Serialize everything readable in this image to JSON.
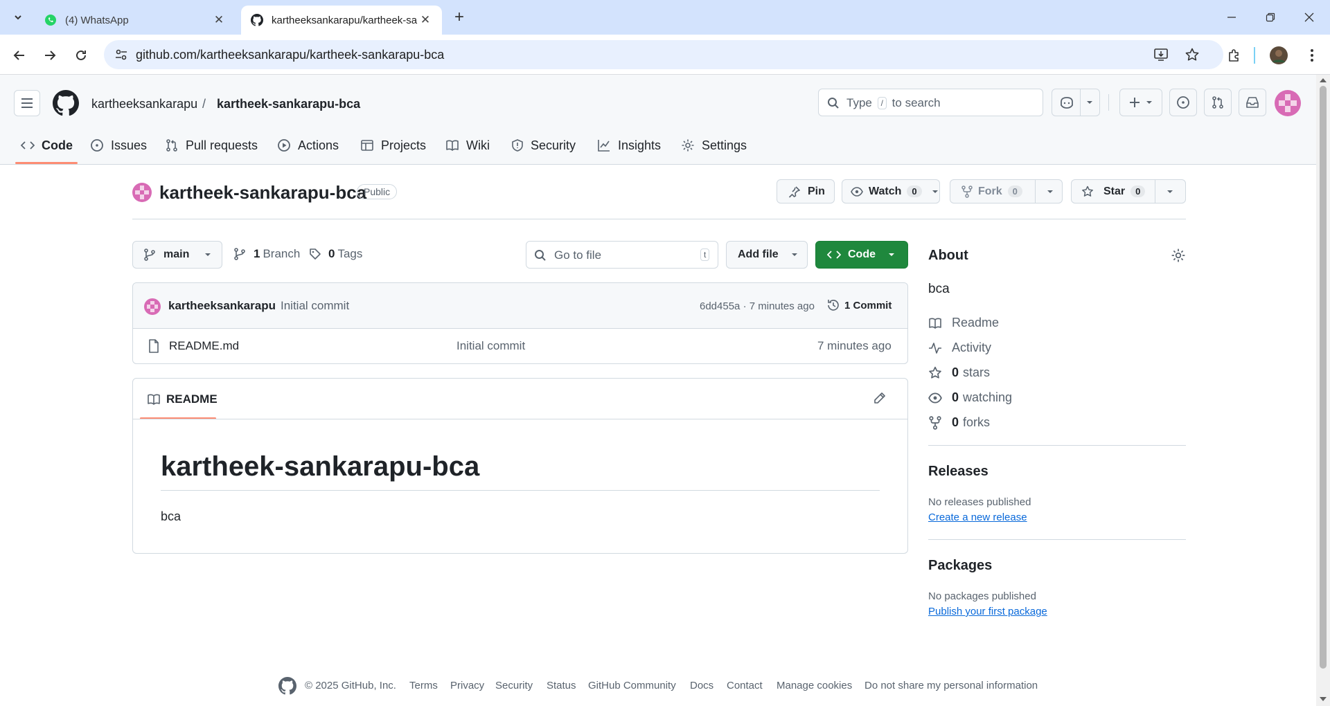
{
  "browser": {
    "tabs": [
      {
        "title": "(4) WhatsApp",
        "active": false
      },
      {
        "title": "kartheeksankarapu/kartheek-sa",
        "active": true
      }
    ],
    "url": "github.com/kartheeksankarapu/kartheek-sankarapu-bca"
  },
  "header": {
    "owner": "kartheeksankarapu",
    "separator": "/",
    "repo": "kartheek-sankarapu-bca",
    "search_prefix": "Type",
    "search_key": "/",
    "search_suffix": "to search"
  },
  "repo_nav": [
    {
      "label": "Code",
      "icon": "code-icon",
      "active": true
    },
    {
      "label": "Issues",
      "icon": "issue-icon"
    },
    {
      "label": "Pull requests",
      "icon": "pull-request-icon"
    },
    {
      "label": "Actions",
      "icon": "play-icon"
    },
    {
      "label": "Projects",
      "icon": "table-icon"
    },
    {
      "label": "Wiki",
      "icon": "book-icon"
    },
    {
      "label": "Security",
      "icon": "shield-icon"
    },
    {
      "label": "Insights",
      "icon": "graph-icon"
    },
    {
      "label": "Settings",
      "icon": "gear-icon"
    }
  ],
  "repo": {
    "name": "kartheek-sankarapu-bca",
    "visibility": "Public",
    "pin_label": "Pin",
    "watch_label": "Watch",
    "watch_count": "0",
    "fork_label": "Fork",
    "fork_count": "0",
    "star_label": "Star",
    "star_count": "0"
  },
  "file_nav": {
    "branch": "main",
    "branch_count": "1",
    "branch_label": "Branch",
    "tag_count": "0",
    "tag_label": "Tags",
    "goto_placeholder": "Go to file",
    "goto_key": "t",
    "add_file_label": "Add file",
    "code_label": "Code"
  },
  "commit": {
    "author": "kartheeksankarapu",
    "message": "Initial commit",
    "hash_time": "6dd455a · 7 minutes ago",
    "commits_count": "1",
    "commits_label": "Commit"
  },
  "files": [
    {
      "name": "README.md",
      "message": "Initial commit",
      "time": "7 minutes ago"
    }
  ],
  "readme": {
    "tab_label": "README",
    "heading": "kartheek-sankarapu-bca",
    "body": "bca"
  },
  "about": {
    "title": "About",
    "description": "bca",
    "readme": "Readme",
    "activity": "Activity",
    "stars_count": "0",
    "stars_label": "stars",
    "watching_count": "0",
    "watching_label": "watching",
    "forks_count": "0",
    "forks_label": "forks"
  },
  "releases": {
    "title": "Releases",
    "empty": "No releases published",
    "link": "Create a new release"
  },
  "packages": {
    "title": "Packages",
    "empty": "No packages published",
    "link": "Publish your first package"
  },
  "footer": {
    "copyright": "© 2025 GitHub, Inc.",
    "links": [
      "Terms",
      "Privacy",
      "Security",
      "Status",
      "GitHub Community",
      "Docs",
      "Contact",
      "Manage cookies",
      "Do not share my personal information"
    ]
  },
  "colors": {
    "accent_green": "#1f883d",
    "link_blue": "#0969da",
    "underline_orange": "#fd8c73",
    "avatar_pink": "#d86bb5"
  }
}
